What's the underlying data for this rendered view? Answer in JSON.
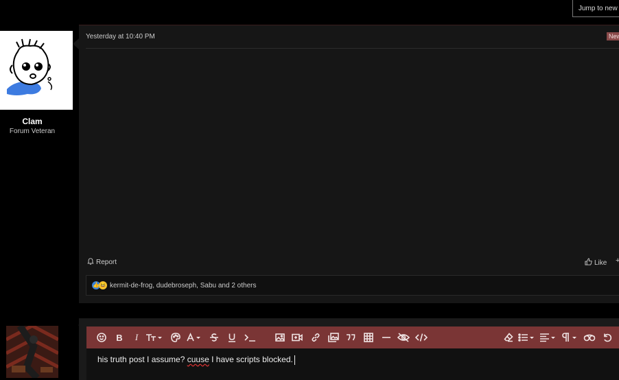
{
  "header": {
    "jump_label": "Jump to new"
  },
  "post": {
    "author": "Clam",
    "author_title": "Forum Veteran",
    "date": "Yesterday at 10:40 PM",
    "new_badge": "New",
    "report_label": "Report",
    "like_label": "Like",
    "more_label": "+",
    "reactions": {
      "icons": [
        "like-reaction-icon",
        "haha-reaction-icon"
      ],
      "text": "kermit-de-frog, dudebroseph, Sabu and 2 others"
    }
  },
  "reply": {
    "text_before": "his truth post I assume? ",
    "misspelled": "cuuse",
    "text_after": " I have scripts blocked.",
    "toolbar_left": [
      "smilie-icon",
      "bold-icon",
      "italic-icon",
      "font-size-icon",
      "color-palette-icon",
      "font-family-icon",
      "strikethrough-icon",
      "underline-icon",
      "inline-code-icon",
      "image-icon",
      "video-icon",
      "link-icon",
      "media-gallery-icon",
      "quote-icon",
      "table-icon",
      "horizontal-rule-icon",
      "spoiler-icon",
      "code-icon"
    ],
    "toolbar_right": [
      "remove-format-icon",
      "list-icon",
      "align-icon",
      "paragraph-icon",
      "preview-icon",
      "undo-icon"
    ]
  },
  "colors": {
    "background": "#000000",
    "panel": "#161616",
    "toolbar": "#7a3535",
    "badge": "#8a4a4a"
  }
}
